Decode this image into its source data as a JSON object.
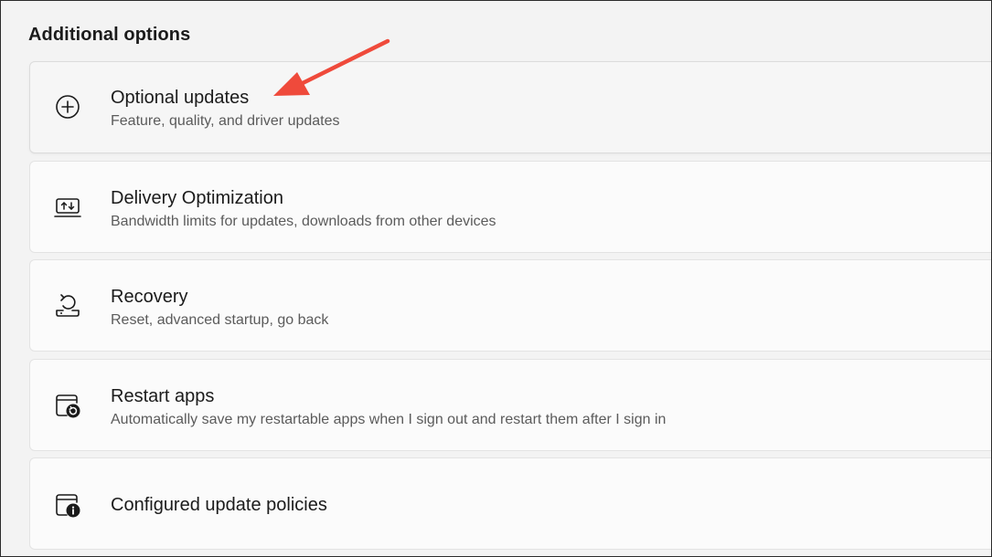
{
  "section": {
    "heading": "Additional options"
  },
  "items": [
    {
      "title": "Optional updates",
      "subtitle": "Feature, quality, and driver updates",
      "icon": "plus-circle-icon"
    },
    {
      "title": "Delivery Optimization",
      "subtitle": "Bandwidth limits for updates, downloads from other devices",
      "icon": "delivery-optimization-icon"
    },
    {
      "title": "Recovery",
      "subtitle": "Reset, advanced startup, go back",
      "icon": "recovery-icon"
    },
    {
      "title": "Restart apps",
      "subtitle": "Automatically save my restartable apps when I sign out and restart them after I sign in",
      "icon": "restart-apps-icon"
    },
    {
      "title": "Configured update policies",
      "subtitle": "",
      "icon": "update-policies-icon"
    }
  ],
  "annotation": {
    "color": "#ef4a3b",
    "icon": "annotation-arrow"
  }
}
